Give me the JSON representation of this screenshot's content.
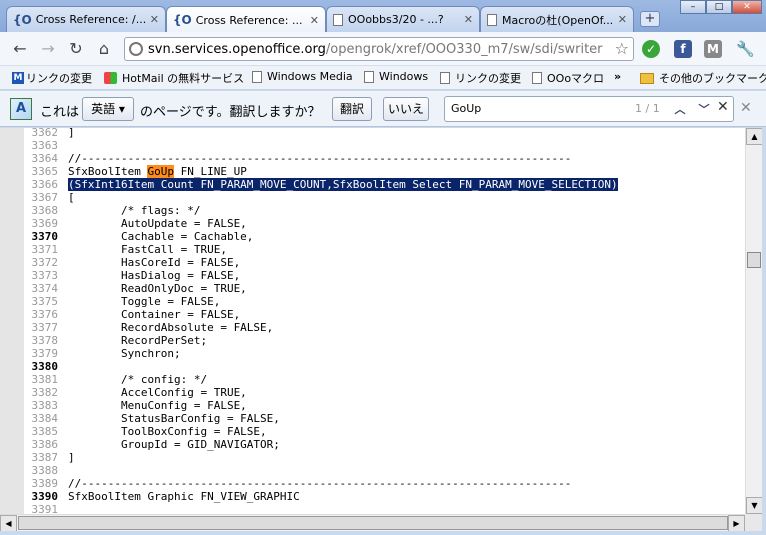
{
  "tabs": [
    {
      "label": "Cross Reference: /...",
      "favicon": "{O"
    },
    {
      "label": "Cross Reference: ...",
      "favicon": "{O"
    },
    {
      "label": "OOobbs3/20 - ...?",
      "favicon": "page"
    },
    {
      "label": "Macroの杜(OpenOf...",
      "favicon": "page"
    }
  ],
  "new_tab": "+",
  "window_controls": [
    "–",
    "□",
    "✕"
  ],
  "address": {
    "host": "svn.services.openoffice.org",
    "path": "/opengrok/xref/OOO330_m7/sw/sdi/swriter"
  },
  "bookmarks": [
    "リンクの変更",
    "HotMail の無料サービス",
    "Windows Media",
    "Windows",
    "リンクの変更",
    "OOoマクロ",
    "»",
    "その他のブックマーク"
  ],
  "translate": {
    "prefix": "これは",
    "language": "英語",
    "suffix": "のページです。翻訳しますか？",
    "translate_btn": "翻訳",
    "no_btn": "いいえ"
  },
  "find": {
    "query": "GoUp",
    "count": "1 / 1"
  },
  "code_lines": [
    {
      "n": "3362",
      "t": "]",
      "bold": false
    },
    {
      "n": "3363",
      "t": "",
      "bold": false
    },
    {
      "n": "3364",
      "t": "//--------------------------------------------------------------------------",
      "bold": false
    },
    {
      "n": "3365",
      "t": "SfxBoolItem GoUp FN_LINE_UP",
      "bold": false,
      "hl": "GoUp"
    },
    {
      "n": "3366",
      "t": "(SfxInt16Item Count FN_PARAM_MOVE_COUNT,SfxBoolItem Select FN_PARAM_MOVE_SELECTION)",
      "bold": false,
      "sel": true
    },
    {
      "n": "3367",
      "t": "[",
      "bold": false
    },
    {
      "n": "3368",
      "t": "        /* flags: */",
      "bold": false
    },
    {
      "n": "3369",
      "t": "        AutoUpdate = FALSE,",
      "bold": false
    },
    {
      "n": "3370",
      "t": "        Cachable = Cachable,",
      "bold": true
    },
    {
      "n": "3371",
      "t": "        FastCall = TRUE,",
      "bold": false
    },
    {
      "n": "3372",
      "t": "        HasCoreId = FALSE,",
      "bold": false
    },
    {
      "n": "3373",
      "t": "        HasDialog = FALSE,",
      "bold": false
    },
    {
      "n": "3374",
      "t": "        ReadOnlyDoc = TRUE,",
      "bold": false
    },
    {
      "n": "3375",
      "t": "        Toggle = FALSE,",
      "bold": false
    },
    {
      "n": "3376",
      "t": "        Container = FALSE,",
      "bold": false
    },
    {
      "n": "3377",
      "t": "        RecordAbsolute = FALSE,",
      "bold": false
    },
    {
      "n": "3378",
      "t": "        RecordPerSet;",
      "bold": false
    },
    {
      "n": "3379",
      "t": "        Synchron;",
      "bold": false
    },
    {
      "n": "3380",
      "t": "",
      "bold": true
    },
    {
      "n": "3381",
      "t": "        /* config: */",
      "bold": false
    },
    {
      "n": "3382",
      "t": "        AccelConfig = TRUE,",
      "bold": false
    },
    {
      "n": "3383",
      "t": "        MenuConfig = FALSE,",
      "bold": false
    },
    {
      "n": "3384",
      "t": "        StatusBarConfig = FALSE,",
      "bold": false
    },
    {
      "n": "3385",
      "t": "        ToolBoxConfig = FALSE,",
      "bold": false
    },
    {
      "n": "3386",
      "t": "        GroupId = GID_NAVIGATOR;",
      "bold": false
    },
    {
      "n": "3387",
      "t": "]",
      "bold": false
    },
    {
      "n": "3388",
      "t": "",
      "bold": false
    },
    {
      "n": "3389",
      "t": "//--------------------------------------------------------------------------",
      "bold": false
    },
    {
      "n": "3390",
      "t": "SfxBoolItem Graphic FN_VIEW_GRAPHIC",
      "bold": true
    },
    {
      "n": "3391",
      "t": "",
      "bold": false
    }
  ]
}
